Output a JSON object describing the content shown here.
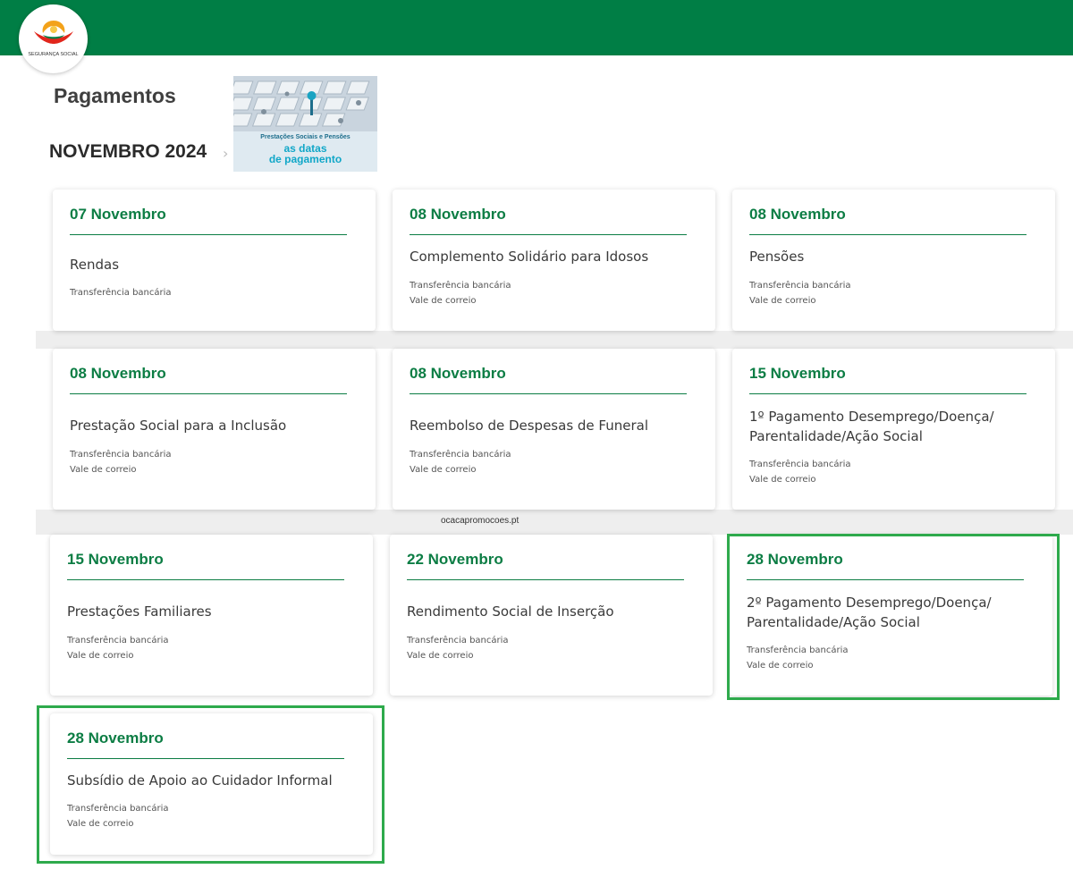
{
  "header": {
    "logo_text": "SEGURANÇA SOCIAL"
  },
  "page_title": "Pagamentos",
  "month_title": "NOVEMBRO 2024",
  "breadcrumb_chevron": "›",
  "banner": {
    "line1": "Prestações Sociais e Pensões",
    "line2": "as datas",
    "line3": "de pagamento"
  },
  "watermark": "ocacapromocoes.pt",
  "colors": {
    "brand_green": "#007e45",
    "date_green": "#0c7d44",
    "highlight_green": "#2eaa4c"
  },
  "cards": [
    {
      "date": "07 Novembro",
      "name": "Rendas",
      "methods": [
        "Transferência bancária"
      ]
    },
    {
      "date": "08 Novembro",
      "name": "Complemento Solidário para Idosos",
      "methods": [
        "Transferência bancária",
        "Vale de correio"
      ]
    },
    {
      "date": "08 Novembro",
      "name": "Pensões",
      "methods": [
        "Transferência bancária",
        "Vale de correio"
      ]
    },
    {
      "date": "08 Novembro",
      "name": "Prestação Social para a Inclusão",
      "methods": [
        "Transferência bancária",
        "Vale de correio"
      ]
    },
    {
      "date": "08 Novembro",
      "name": "Reembolso de Despesas de Funeral",
      "methods": [
        "Transferência bancária",
        "Vale de correio"
      ]
    },
    {
      "date": "15 Novembro",
      "name": "1º Pagamento Desemprego/Doença/ Parentalidade/Ação Social",
      "methods": [
        "Transferência bancária",
        "Vale de correio"
      ]
    },
    {
      "date": "15 Novembro",
      "name": "Prestações Familiares",
      "methods": [
        "Transferência bancária",
        "Vale de correio"
      ]
    },
    {
      "date": "22 Novembro",
      "name": "Rendimento Social de Inserção",
      "methods": [
        "Transferência bancária",
        "Vale de correio"
      ]
    },
    {
      "date": "28 Novembro",
      "name": "2º Pagamento Desemprego/Doença/ Parentalidade/Ação Social",
      "methods": [
        "Transferência bancária",
        "Vale de correio"
      ]
    },
    {
      "date": "28 Novembro",
      "name": "Subsídio de Apoio ao Cuidador Informal",
      "methods": [
        "Transferência bancária",
        "Vale de correio"
      ]
    }
  ]
}
